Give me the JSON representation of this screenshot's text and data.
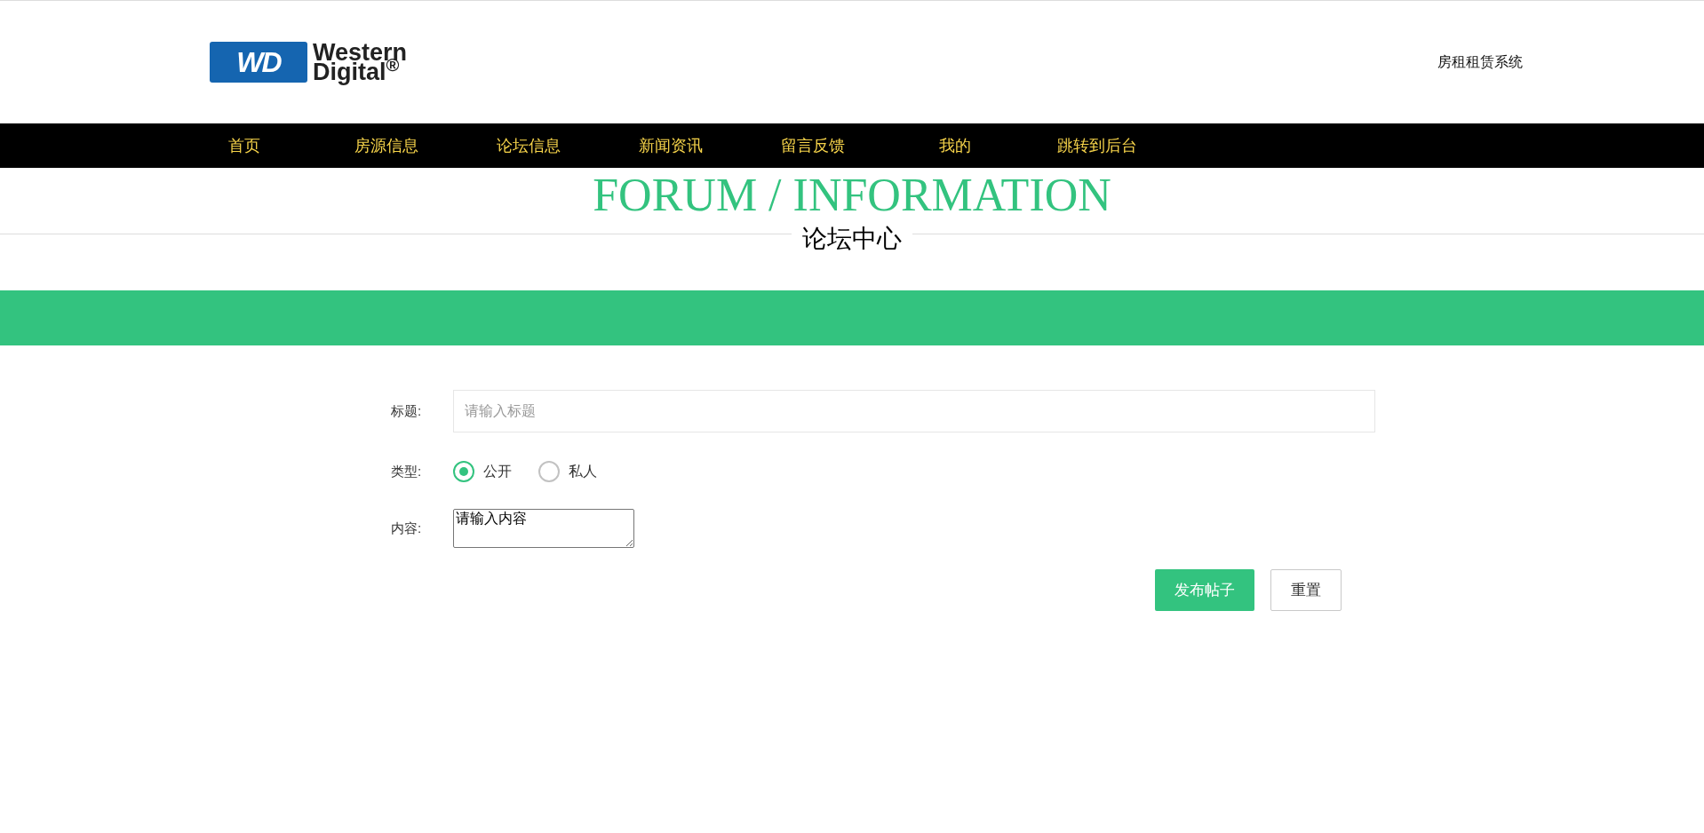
{
  "logo": {
    "mark": "WD",
    "lines": [
      "Western",
      "Digital$^{®}$"
    ]
  },
  "header": {
    "system_name": "房租租赁系统"
  },
  "nav": [
    {
      "label": "首页"
    },
    {
      "label": "房源信息"
    },
    {
      "label": "论坛信息"
    },
    {
      "label": "新闻资讯"
    },
    {
      "label": "留言反馈"
    },
    {
      "label": "我的"
    },
    {
      "label": "跳转到后台"
    }
  ],
  "section": {
    "title": "FORUM / INFORMATION",
    "subtitle": "论坛中心"
  },
  "form": {
    "fields": [
      {
        "kind": "text",
        "label": "标题:",
        "placeholder": "请输入标题"
      },
      {
        "kind": "radio",
        "label": "类型:",
        "options": [
          {
            "label": "公开",
            "selected": true
          },
          {
            "label": "私人",
            "selected": false
          }
        ]
      },
      {
        "kind": "textarea",
        "label": "内容:",
        "value": "请输入内容"
      }
    ],
    "buttons": [
      {
        "label": "发布帖子",
        "kind": "primary"
      },
      {
        "label": "重置",
        "kind": "secondary"
      }
    ]
  }
}
